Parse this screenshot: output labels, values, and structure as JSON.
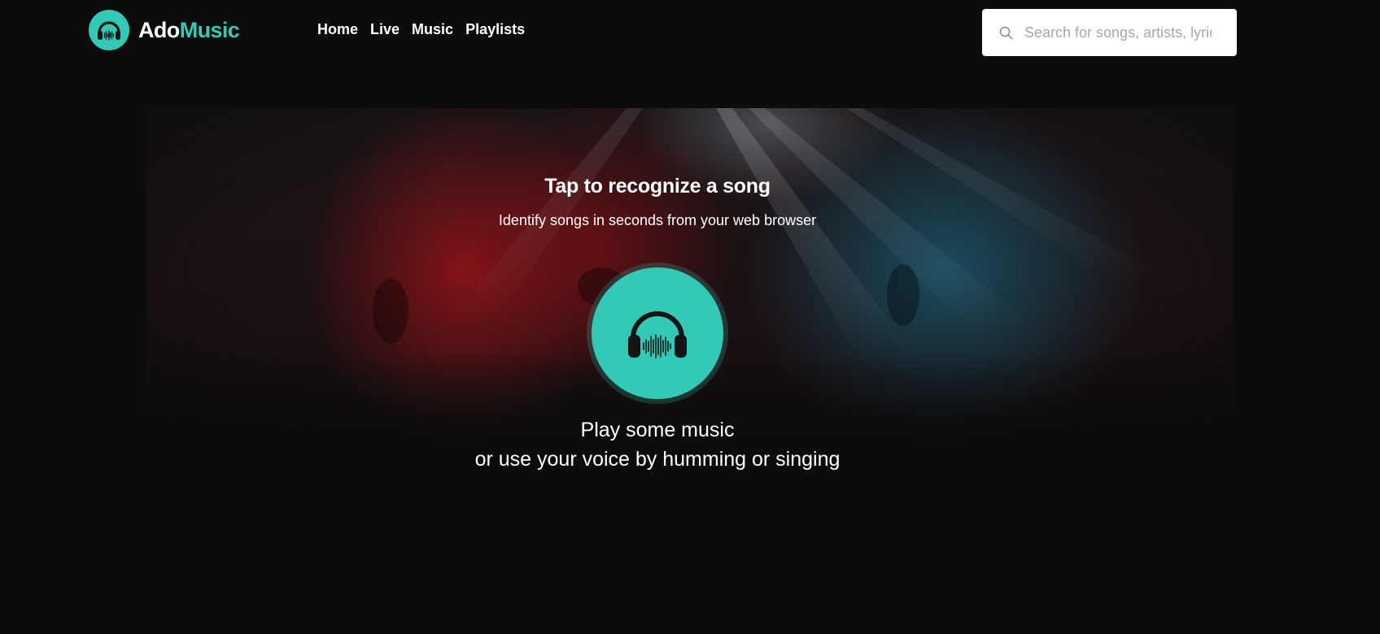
{
  "brand": {
    "name_part1": "Ado",
    "name_part2": "Music",
    "logo_icon": "headphones-soundwave-icon",
    "accent_color": "#34c8b6"
  },
  "nav": {
    "items": [
      {
        "label": "Home"
      },
      {
        "label": "Live"
      },
      {
        "label": "Music"
      },
      {
        "label": "Playlists"
      }
    ]
  },
  "search": {
    "placeholder": "Search for songs, artists, lyrics",
    "value": "",
    "icon": "search-icon"
  },
  "hero": {
    "title": "Tap to recognize a song",
    "subtitle": "Identify songs in seconds from your web browser",
    "button_icon": "headphones-soundwave-icon",
    "caption_line1": "Play some music",
    "caption_line2": "or use your voice by humming or singing"
  },
  "colors": {
    "background": "#0c0c0d",
    "accent": "#34c8b6",
    "text": "#ffffff"
  }
}
